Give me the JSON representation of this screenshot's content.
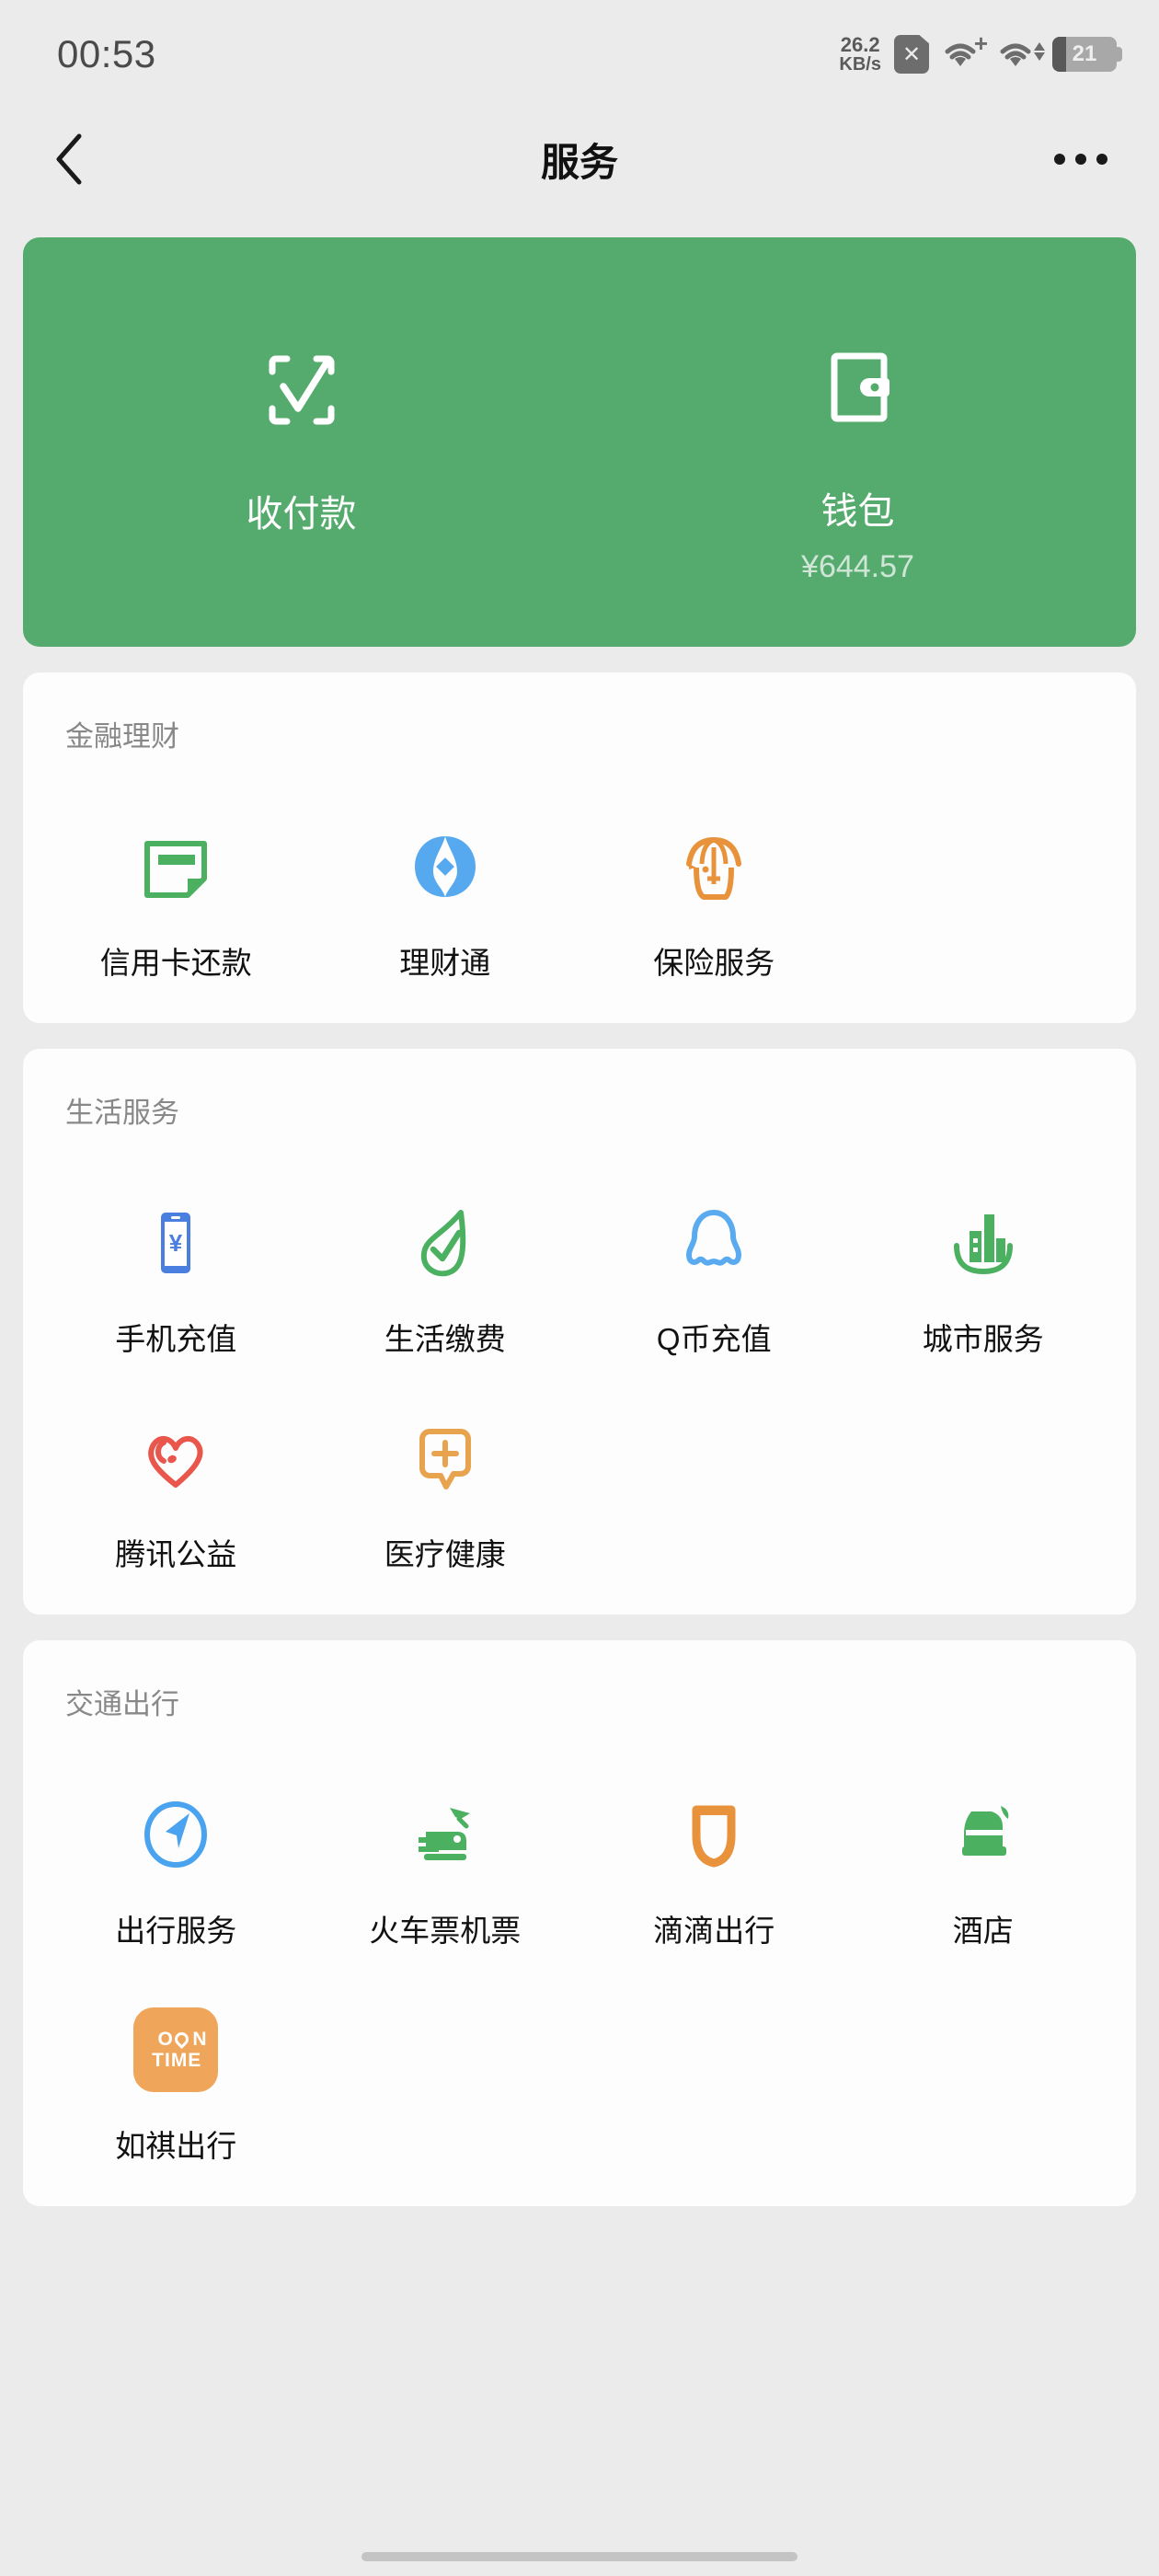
{
  "status_bar": {
    "time": "00:53",
    "net_speed_value": "26.2",
    "net_speed_unit": "KB/s",
    "sim_icon": "sim-card-x-icon",
    "wifi_icon": "wifi-plus-icon",
    "wifi2_icon": "wifi-updown-icon",
    "battery_level": "21",
    "battery_percent": 21
  },
  "nav": {
    "back_icon": "chevron-left-icon",
    "title": "服务",
    "more_icon": "more-horizontal-icon"
  },
  "pay_card": {
    "background_color": "#55ab6d",
    "items": [
      {
        "icon": "scan-pay-icon",
        "label": "收付款",
        "sub": ""
      },
      {
        "icon": "wallet-icon",
        "label": "钱包",
        "sub": "¥644.57"
      }
    ]
  },
  "sections": [
    {
      "title": "金融理财",
      "items": [
        {
          "icon": "credit-card-icon",
          "label": "信用卡还款",
          "color": "#4cb061"
        },
        {
          "icon": "licaitong-icon",
          "label": "理财通",
          "color": "#57a9ef"
        },
        {
          "icon": "insurance-umbrella-icon",
          "label": "保险服务",
          "color": "#e8933c"
        }
      ]
    },
    {
      "title": "生活服务",
      "items": [
        {
          "icon": "phone-recharge-icon",
          "label": "手机充值",
          "color": "#4a7fe0"
        },
        {
          "icon": "utility-bill-icon",
          "label": "生活缴费",
          "color": "#4cb061"
        },
        {
          "icon": "qcoin-penguin-icon",
          "label": "Q币充值",
          "color": "#5aaaf0"
        },
        {
          "icon": "city-service-icon",
          "label": "城市服务",
          "color": "#4cb061"
        },
        {
          "icon": "tencent-charity-icon",
          "label": "腾讯公益",
          "color": "#e8564c"
        },
        {
          "icon": "medical-health-icon",
          "label": "医疗健康",
          "color": "#e8a košt"
        }
      ]
    },
    {
      "title": "交通出行",
      "items": [
        {
          "icon": "navigation-arrow-icon",
          "label": "出行服务",
          "color": "#4aa3ef"
        },
        {
          "icon": "train-plane-icon",
          "label": "火车票机票",
          "color": "#4cb061"
        },
        {
          "icon": "didi-icon",
          "label": "滴滴出行",
          "color": "#e8933c"
        },
        {
          "icon": "hotel-bed-icon",
          "label": "酒店",
          "color": "#4cb061"
        },
        {
          "icon": "ontime-app-icon",
          "label": "如祺出行",
          "color": "#efa65b"
        }
      ]
    }
  ]
}
